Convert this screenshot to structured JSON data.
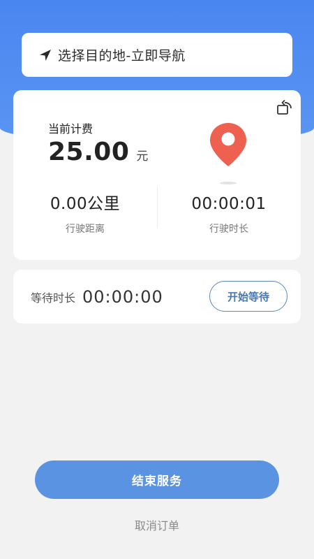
{
  "navigation": {
    "icon": "navigation-arrow-icon",
    "label": "选择目的地-立即导航"
  },
  "fare": {
    "label": "当前计费",
    "amount": "25.00",
    "unit": "元"
  },
  "stats": {
    "distance": {
      "value": "0.00公里",
      "label": "行驶距离"
    },
    "duration": {
      "value": "00:00:01",
      "label": "行驶时长"
    }
  },
  "waiting": {
    "label": "等待时长",
    "time": "00:00:00",
    "start_button": "开始等待"
  },
  "actions": {
    "end_service": "结束服务",
    "cancel_order": "取消订单"
  },
  "colors": {
    "header_blue": "#4a86f0",
    "primary_button": "#5b93e3",
    "outline_button": "#5b86b9",
    "pin_red": "#ee6050"
  },
  "icons": [
    "navigation-arrow-icon",
    "rotate-icon",
    "map-pin-icon"
  ]
}
